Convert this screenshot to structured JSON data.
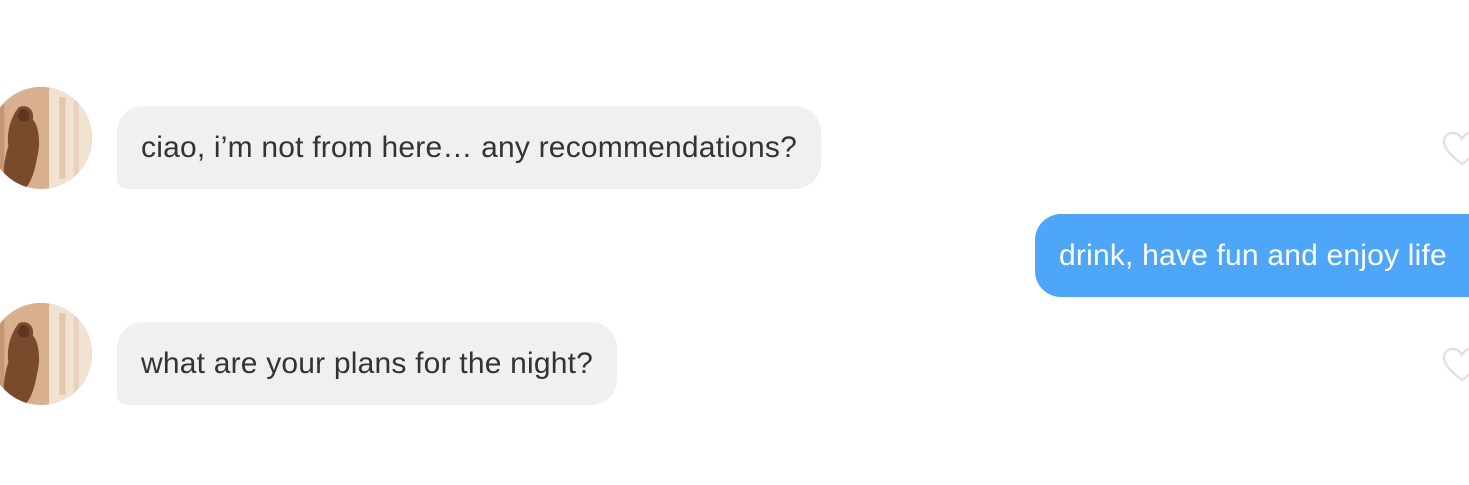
{
  "messages": [
    {
      "sender": "match",
      "text": "ciao, i’m not from here… any recommendations?",
      "avatar_icon": "profile-photo",
      "like_icon": "heart-outline-icon"
    },
    {
      "sender": "me",
      "text": "drink, have fun and enjoy life"
    },
    {
      "sender": "match",
      "text": "what are your plans for the night?",
      "avatar_icon": "profile-photo",
      "like_icon": "heart-outline-icon"
    }
  ],
  "colors": {
    "received_bubble": "#f0f0f0",
    "received_text": "#333333",
    "sent_bubble": "#4ea6f9",
    "sent_text": "#ffffff",
    "heart_outline": "#e2e2e2"
  }
}
